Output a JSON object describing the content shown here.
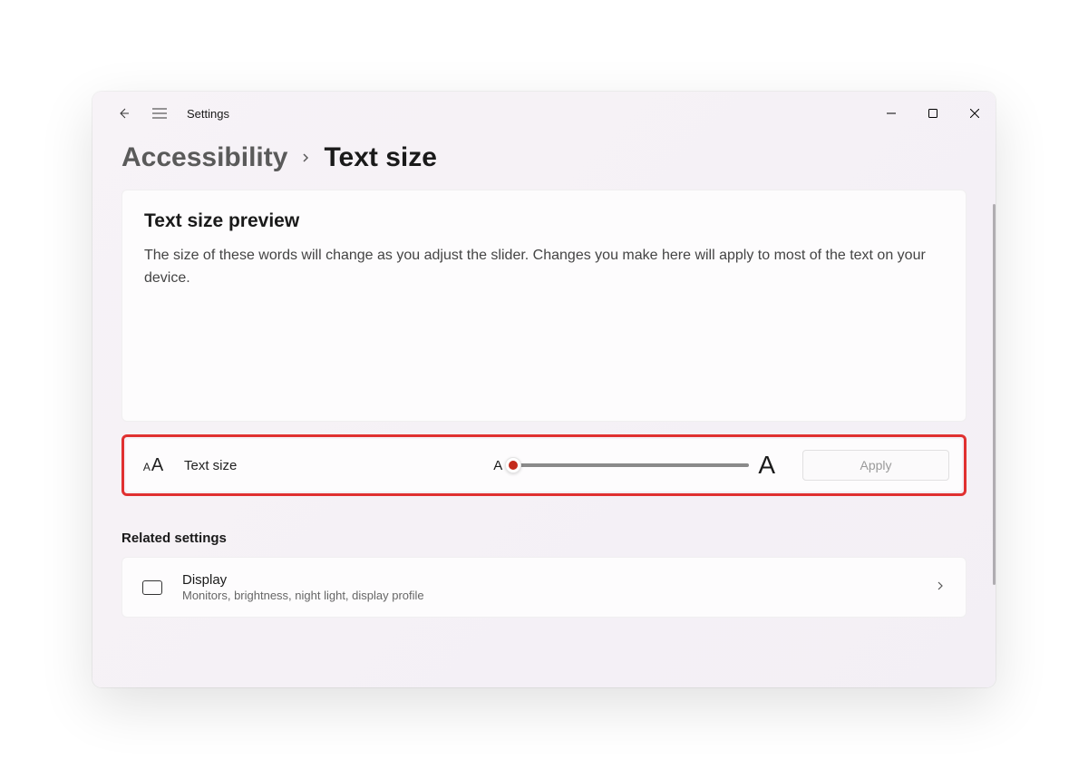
{
  "titlebar": {
    "title": "Settings"
  },
  "breadcrumb": {
    "parent": "Accessibility",
    "current": "Text size"
  },
  "preview": {
    "heading": "Text size preview",
    "body": "The size of these words will change as you adjust the slider. Changes you make here will apply to most of the text on your device."
  },
  "slider": {
    "label": "Text size",
    "min_glyph": "A",
    "max_glyph": "A",
    "apply_label": "Apply"
  },
  "related": {
    "heading": "Related settings",
    "items": [
      {
        "title": "Display",
        "subtitle": "Monitors, brightness, night light, display profile"
      }
    ]
  }
}
